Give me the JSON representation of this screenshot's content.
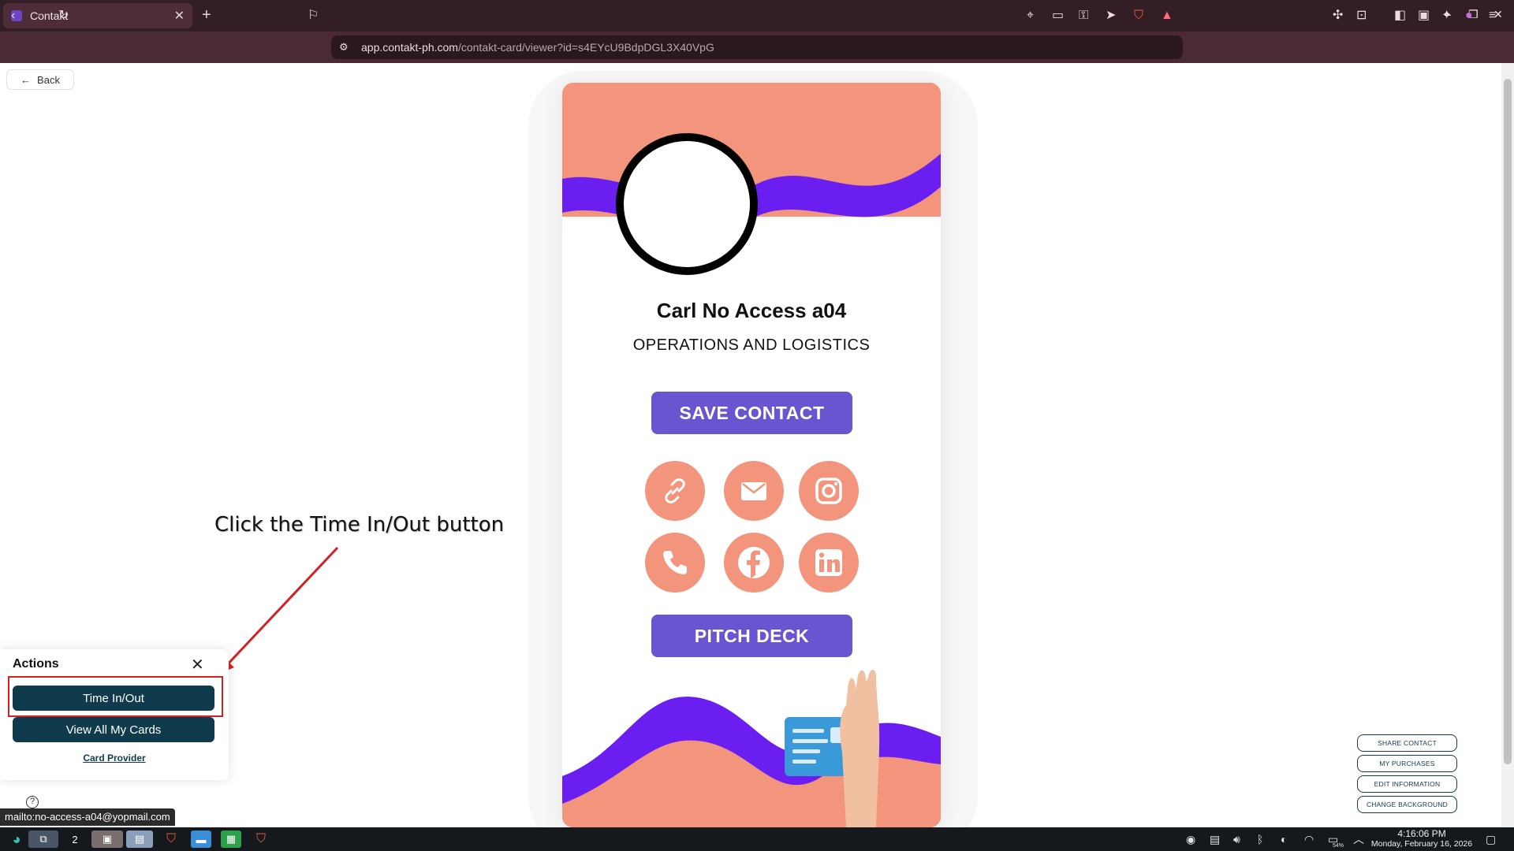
{
  "browser": {
    "tab_title": "Contakt",
    "url_host": "app.contakt-ph.com",
    "url_path": "/contakt-card/viewer?id=s4EYcU9BdpDGL3X40VpG",
    "status_url": "mailto:no-access-a04@yopmail.com"
  },
  "page": {
    "back_label": "Back",
    "card": {
      "name": "Carl No Access a04",
      "department": "OPERATIONS AND LOGISTICS",
      "save_contact_label": "SAVE CONTACT",
      "pitch_deck_label": "PITCH DECK",
      "social_icons": [
        "link-icon",
        "email-icon",
        "instagram-icon",
        "phone-icon",
        "facebook-icon",
        "linkedin-icon"
      ],
      "colors": {
        "wave_top": "#f2957c",
        "wave_band": "#6a1ff0",
        "button": "#6a55d0",
        "social": "#f2957c"
      }
    },
    "instruction_text": "Click the Time In/Out button",
    "actions_panel": {
      "title": "Actions",
      "time_in_out_label": "Time In/Out",
      "view_cards_label": "View All My Cards",
      "card_provider_label": "Card Provider",
      "button_color": "#0f3b4c"
    },
    "side_buttons": {
      "share_contact": "SHARE CONTACT",
      "my_purchases": "MY PURCHASES",
      "edit_information": "EDIT INFORMATION",
      "change_background": "CHANGE BACKGROUND"
    }
  },
  "taskbar": {
    "workspace_number": "2",
    "time": "4:16:06 PM",
    "date": "Monday, February 16, 2026",
    "battery": "54%"
  }
}
